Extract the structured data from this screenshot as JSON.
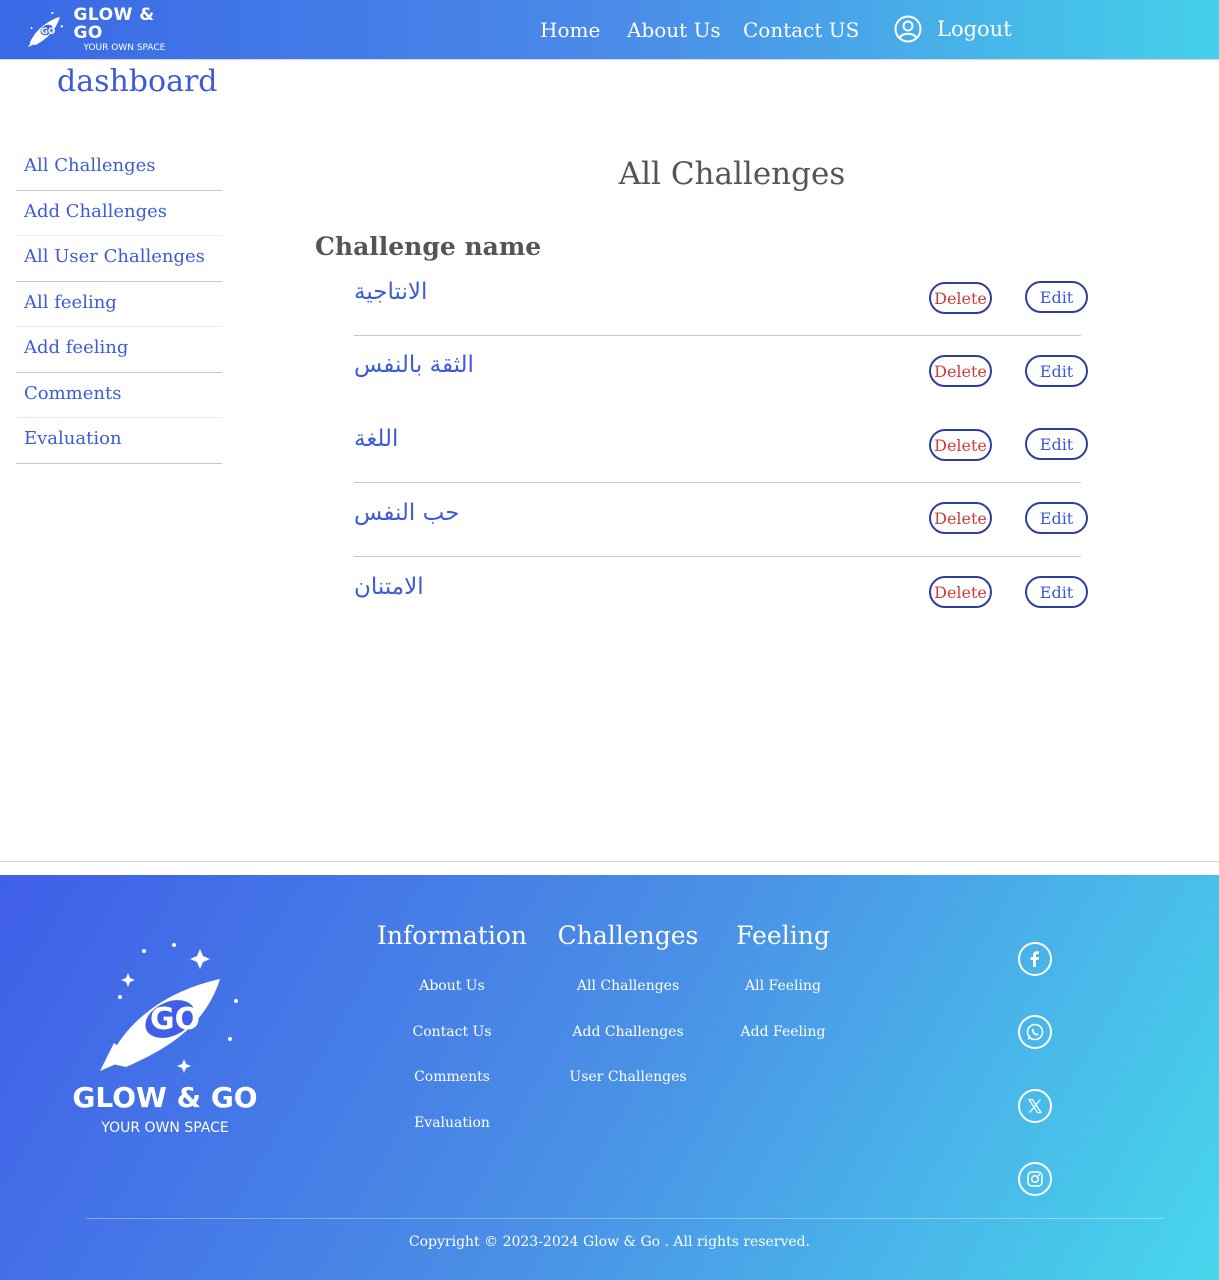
{
  "header": {
    "brand_line1": "GLOW & GO",
    "brand_line2": "YOUR OWN SPACE",
    "nav": {
      "home": "Home",
      "about": "About Us",
      "contact": "Contact US"
    },
    "logout": "Logout"
  },
  "page_title": "dashboard",
  "sidebar": {
    "items": [
      {
        "label": "All Challenges"
      },
      {
        "label": "Add Challenges"
      },
      {
        "label": "All User Challenges"
      },
      {
        "label": "All feeling"
      },
      {
        "label": "Add feeling"
      },
      {
        "label": "Comments"
      },
      {
        "label": "Evaluation"
      }
    ]
  },
  "main": {
    "title": "All Challenges",
    "column_header": "Challenge name",
    "delete_label": "Delete",
    "edit_label": "Edit",
    "challenges": [
      {
        "name": "الانتاجية"
      },
      {
        "name": "الثقة بالنفس"
      },
      {
        "name": "اللغة"
      },
      {
        "name": "حب النفس"
      },
      {
        "name": "الامتنان"
      }
    ]
  },
  "footer": {
    "brand_line1": "GLOW & GO",
    "brand_line2": "YOUR OWN SPACE",
    "information": {
      "heading": "Information",
      "links": [
        "About Us",
        "Contact Us",
        "Comments",
        "Evaluation"
      ]
    },
    "challenges": {
      "heading": "Challenges",
      "links": [
        "All Challenges",
        "Add Challenges",
        "User Challenges"
      ]
    },
    "feeling": {
      "heading": "Feeling",
      "links": [
        "All Feeling",
        "Add Feeling"
      ]
    },
    "social_icons": [
      "facebook-icon",
      "whatsapp-icon",
      "x-twitter-icon",
      "instagram-icon"
    ],
    "copyright": "Copyright © 2023-2024 Glow & Go . All rights reserved."
  },
  "colors": {
    "accent": "#3d5bd9",
    "delete": "#d23a3a",
    "gradient_start": "#3a68e6",
    "gradient_end": "#45d0ea"
  }
}
